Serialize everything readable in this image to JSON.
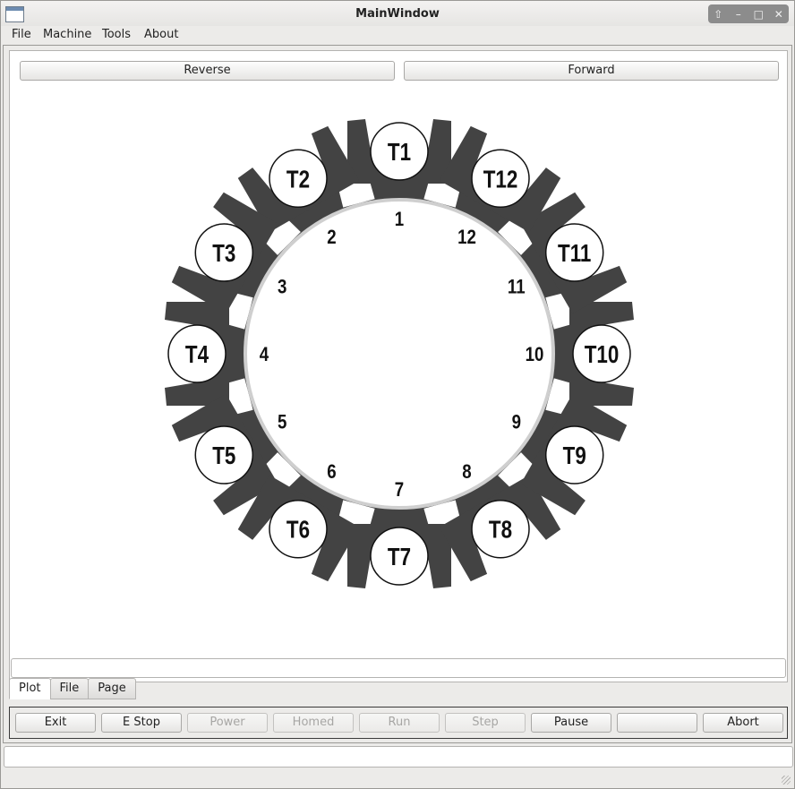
{
  "window": {
    "title": "MainWindow"
  },
  "menu": [
    "File",
    "Machine",
    "Tools",
    "About"
  ],
  "top_buttons": {
    "reverse": "Reverse",
    "forward": "Forward"
  },
  "carousel": {
    "slot_numbers": [
      "1",
      "2",
      "3",
      "4",
      "5",
      "6",
      "7",
      "8",
      "9",
      "10",
      "11",
      "12"
    ],
    "tool_labels": [
      "T1",
      "T2",
      "T3",
      "T4",
      "T5",
      "T6",
      "T7",
      "T8",
      "T9",
      "T10",
      "T11",
      "T12"
    ]
  },
  "tabs": [
    "Plot",
    "File",
    "Page"
  ],
  "active_tab": "Plot",
  "bottom_buttons": [
    {
      "label": "Exit",
      "enabled": true
    },
    {
      "label": "E Stop",
      "enabled": true
    },
    {
      "label": "Power",
      "enabled": false
    },
    {
      "label": "Homed",
      "enabled": false
    },
    {
      "label": "Run",
      "enabled": false
    },
    {
      "label": "Step",
      "enabled": false
    },
    {
      "label": "Pause",
      "enabled": true
    },
    {
      "label": "",
      "enabled": true
    },
    {
      "label": "Abort",
      "enabled": true
    }
  ],
  "colors": {
    "arm": "#434343",
    "ring": "#cfcfcf",
    "window_bg": "#ecebe9"
  }
}
